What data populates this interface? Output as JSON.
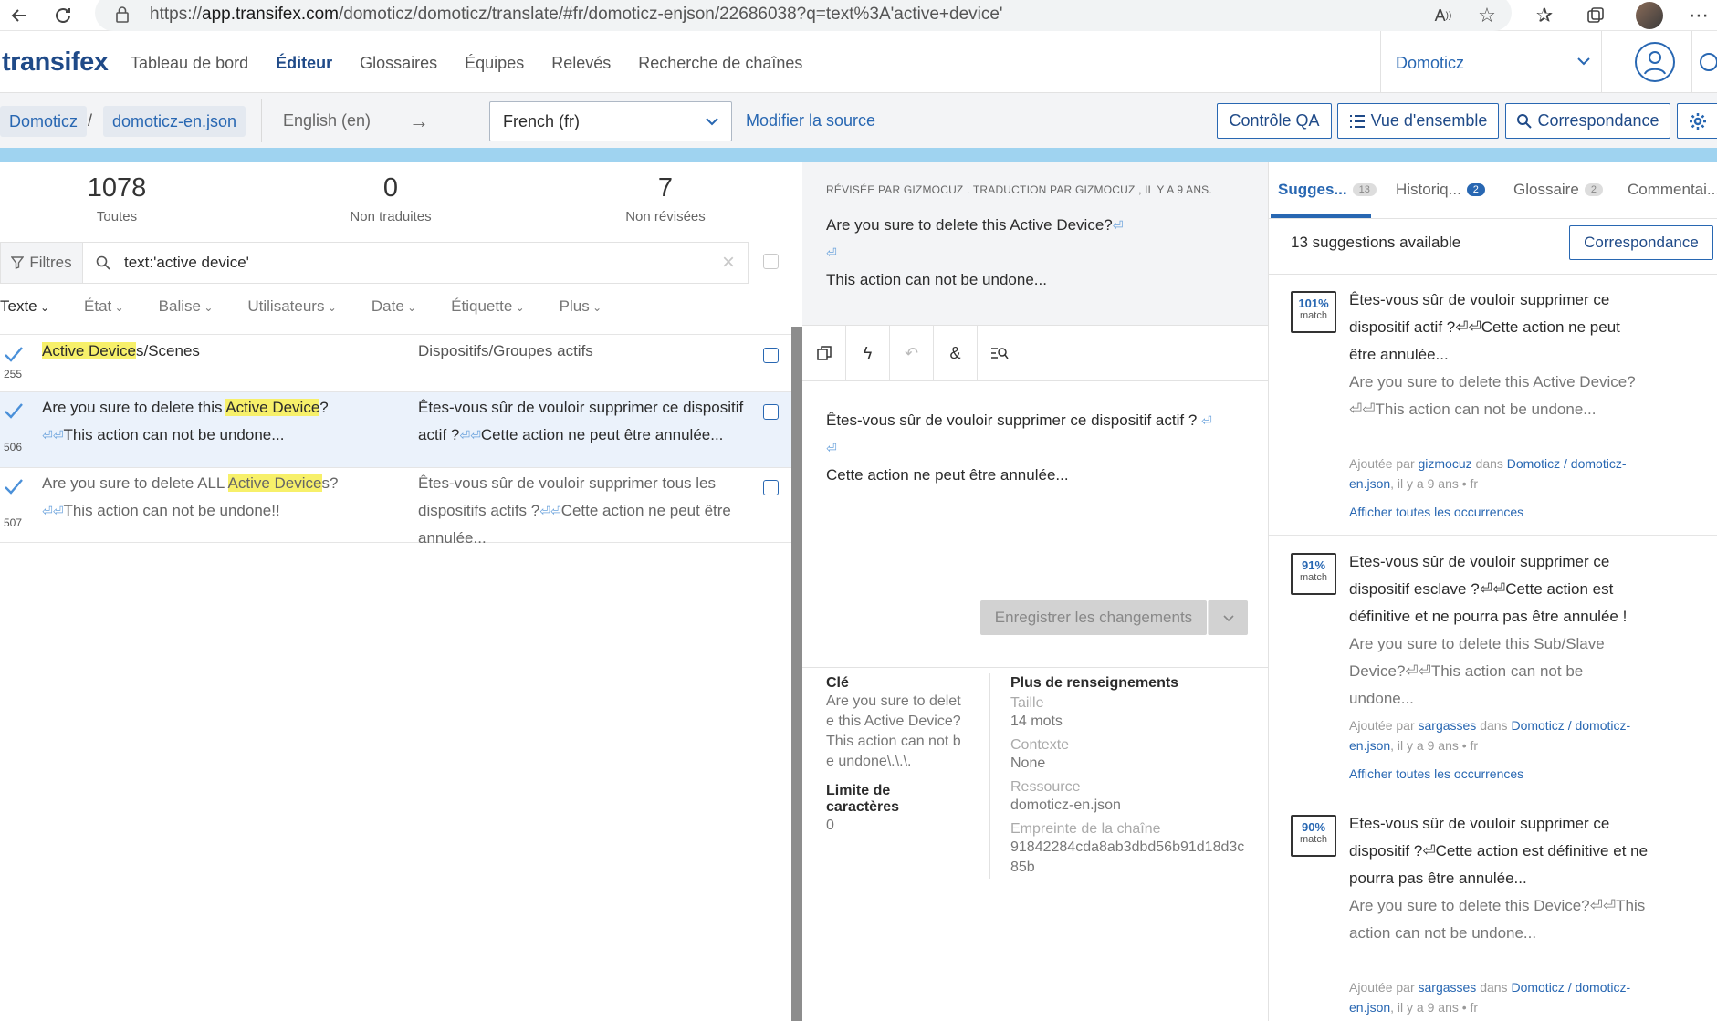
{
  "browser": {
    "url_prefix": "https://",
    "url_host": "app.transifex.com",
    "url_path": "/domoticz/domoticz/translate/#fr/domoticz-enjson/22686038?q=text%3A'active+device'"
  },
  "header": {
    "logo": "transifex",
    "nav": [
      "Tableau de bord",
      "Éditeur",
      "Glossaires",
      "Équipes",
      "Relevés",
      "Recherche de chaînes"
    ],
    "project": "Domoticz"
  },
  "toolbar": {
    "crumb_project": "Domoticz",
    "crumb_separator": "/",
    "crumb_resource": "domoticz-en.json",
    "source_lang": "English (en)",
    "arrow": "→",
    "target_lang": "French (fr)",
    "modify_source": "Modifier la source",
    "qa_button": "Contrôle QA",
    "overview_button": "Vue d'ensemble",
    "match_button": "Correspondance"
  },
  "stats": {
    "all_count": "1078",
    "all_label": "Toutes",
    "untranslated_count": "0",
    "untranslated_label": "Non traduites",
    "unreviewed_count": "7",
    "unreviewed_label": "Non révisées"
  },
  "filters": {
    "label": "Filtres",
    "query": "text:'active device'",
    "columns": [
      "Texte",
      "État",
      "Balise",
      "Utilisateurs",
      "Date",
      "Étiquette",
      "Plus"
    ]
  },
  "rows": [
    {
      "id": "255",
      "src_hl": "Active Device",
      "src_rest": "s/Scenes",
      "target": "Dispositifs/Groupes actifs"
    },
    {
      "id": "506",
      "src_pre": "Are you sure to delete this ",
      "src_hl": "Active Device",
      "src_rest": "?",
      "src_tail": "This action can not be undone...",
      "tgt_pre": "Êtes-vous sûr de vouloir supprimer ce dispositif actif ?",
      "tgt_tail": "Cette action ne peut être annulée..."
    },
    {
      "id": "507",
      "src_pre": "Are you sure to delete ALL ",
      "src_hl": "Active Device",
      "src_rest": "s?",
      "src_tail": "This action can not be undone!!",
      "tgt_pre": "Êtes-vous sûr de vouloir supprimer tous les dispositifs actifs ?",
      "tgt_tail": "Cette action ne peut être annulée..."
    }
  ],
  "editor": {
    "meta": "RÉVISÉE PAR GIZMOCUZ . TRADUCTION PAR GIZMOCUZ , IL Y A 9 ANS.",
    "source_line1_pre": "Are you sure to delete this Active ",
    "source_line1_u": "Device",
    "source_line1_end": "?",
    "source_line3": "This action can not be undone...",
    "newline_glyph": "⏎",
    "translation_line1": "Êtes-vous sûr de vouloir supprimer ce dispositif actif ?",
    "translation_line3": "Cette action ne peut être annulée...",
    "save_label": "Enregistrer les changements",
    "key_label": "Clé",
    "key_value": "Are you sure to delete this Active Device? This action can not be undone\\.\\.\\.",
    "limit_label": "Limite de caractères",
    "limit_value": "0",
    "more_label": "Plus de renseignements",
    "size_label": "Taille",
    "size_value": "14 mots",
    "context_label": "Contexte",
    "context_value": "None",
    "resource_label": "Ressource",
    "resource_value": "domoticz-en.json",
    "hash_label": "Empreinte de la chaîne",
    "hash_value": "91842284cda8ab3dbd56b91d18d3c85b"
  },
  "right": {
    "tabs": [
      {
        "label": "Sugges...",
        "count": "13"
      },
      {
        "label": "Historiq...",
        "count": "2"
      },
      {
        "label": "Glossaire",
        "count": "2"
      },
      {
        "label": "Commentai..."
      }
    ],
    "count_text": "13 suggestions available",
    "match_button": "Correspondance",
    "added_by": "Ajoutée par",
    "in": "dans",
    "show_all": "Afficher toutes les occurrences",
    "match_word": "match",
    "suggestions": [
      {
        "pct": "101%",
        "t1": "Êtes-vous sûr de vouloir supprimer ce dispositif actif ?",
        "t2": "Cette action ne peut être annulée...",
        "s1": "Are you sure to delete this Active Device?",
        "s2": "This action can not be undone...",
        "user": "gizmocuz",
        "res": "Domoticz / domoticz-en.json",
        "meta": ", il y a 9 ans • fr"
      },
      {
        "pct": "91%",
        "t1": "Etes-vous sûr de vouloir supprimer ce dispositif esclave ?",
        "t2": "Cette action est définitive et ne pourra pas être annulée !",
        "s1": "Are you sure to delete this Sub/Slave Device?",
        "s2": "This action can not be undone...",
        "user": "sargasses",
        "res": "Domoticz / domoticz-en.json",
        "meta": ", il y a 9 ans • fr"
      },
      {
        "pct": "90%",
        "t1": "Etes-vous sûr de vouloir supprimer ce dispositif ?",
        "t2": "Cette action est définitive et ne pourra pas être annulée...",
        "s1": "Are you sure to delete this Device?",
        "s2": "This action can not be undone...",
        "user": "sargasses",
        "res": "Domoticz / domoticz-en.json",
        "meta": ", il y a 9 ans • fr"
      }
    ]
  },
  "colors": {
    "brand": "#1f4a88",
    "accent": "#2867b2",
    "highlight": "#f7f06a",
    "progress": "#9fd3f0"
  }
}
